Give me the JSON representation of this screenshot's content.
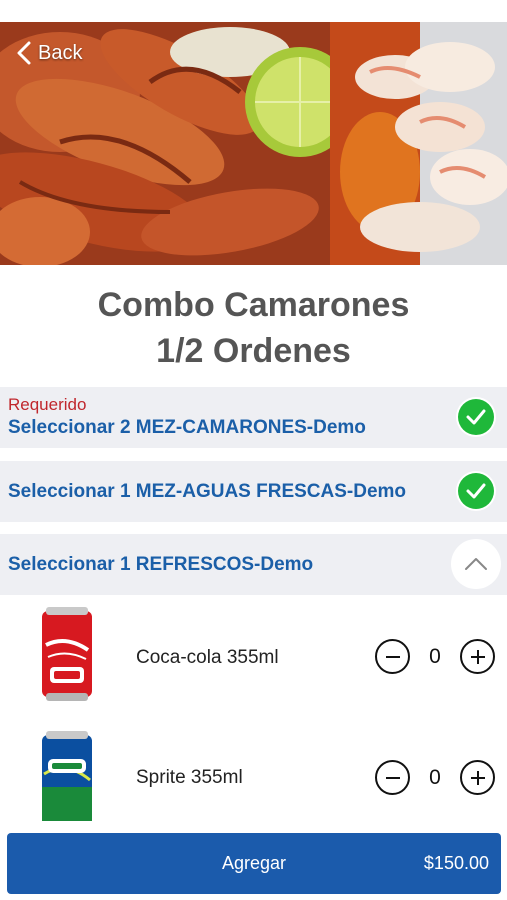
{
  "header": {
    "back_label": "Back"
  },
  "product": {
    "title_line1": "Combo Camarones",
    "title_line2": "1/2 Ordenes"
  },
  "sections": [
    {
      "required_label": "Requerido",
      "label": "Seleccionar 2 MEZ-CAMARONES-Demo",
      "state": "complete"
    },
    {
      "label": "Seleccionar 1 MEZ-AGUAS FRESCAS-Demo",
      "state": "complete"
    },
    {
      "label": "Seleccionar 1 REFRESCOS-Demo",
      "state": "expanded"
    }
  ],
  "options": [
    {
      "name": "Coca-cola 355ml",
      "qty": "0",
      "icon": "coca-cola-can"
    },
    {
      "name": "Sprite 355ml",
      "qty": "0",
      "icon": "sprite-can"
    }
  ],
  "footer": {
    "add_label": "Agregar",
    "price": "$150.00"
  },
  "colors": {
    "accent": "#1b5bac",
    "link": "#1b5fa8",
    "required": "#c0272d",
    "check": "#1fb83a"
  }
}
